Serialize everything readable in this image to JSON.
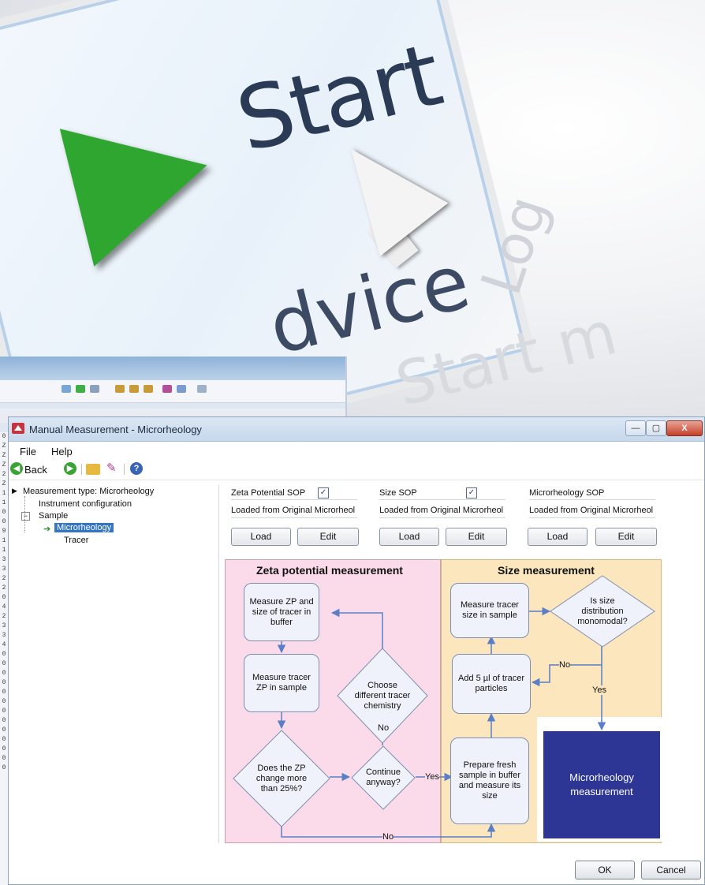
{
  "hero": {
    "start_text": "Start",
    "advice_text": "dvice",
    "log_text": "Log",
    "start_menu_text": "Start m"
  },
  "background_app": {
    "row_digits": [
      "0",
      "Z",
      "Z",
      "Z",
      "2",
      "Z",
      "1",
      "1",
      "0",
      "0",
      "9",
      "1",
      "1",
      "3",
      "3",
      "2",
      "2",
      "0",
      "4",
      "2",
      "3",
      "3",
      "4",
      "0",
      "0",
      "0",
      "0",
      "0",
      "0",
      "0",
      "0",
      "0",
      "0",
      "0",
      "0",
      "0"
    ]
  },
  "window": {
    "title": "Manual Measurement - Microrheology",
    "controls": {
      "minimize": "—",
      "maximize": "▢",
      "close": "X"
    }
  },
  "menu": {
    "file": "File",
    "help": "Help"
  },
  "toolbar": {
    "back_label": "Back"
  },
  "tree": {
    "root": "Measurement type: Microrheology",
    "instrument": "Instrument configuration",
    "sample": "Sample",
    "microrheology": "Microrheology",
    "tracer": "Tracer"
  },
  "sops": [
    {
      "label": "Zeta Potential SOP",
      "checked": true,
      "status": "Loaded from Original Microrheol",
      "load": "Load",
      "edit": "Edit"
    },
    {
      "label": "Size SOP",
      "checked": true,
      "status": "Loaded from Original Microrheol",
      "load": "Load",
      "edit": "Edit"
    },
    {
      "label": "Microrheology SOP",
      "checked": false,
      "status": "Loaded from Original Microrheol",
      "load": "Load",
      "edit": "Edit"
    }
  ],
  "flowchart": {
    "zp_title": "Zeta potential measurement",
    "size_title": "Size measurement",
    "measure_zp": "Measure ZP and size of tracer in buffer",
    "measure_tracer_zp": "Measure tracer ZP in sample",
    "does_change": "Does the ZP change more than 25%?",
    "choose_tracer": "Choose different tracer chemistry",
    "continue_anyway": "Continue anyway?",
    "prepare_fresh": "Prepare fresh sample in buffer and measure its size",
    "add_tracer": "Add 5 µl of tracer particles",
    "measure_size": "Measure tracer size in sample",
    "is_monomodal": "Is size distribution monomodal?",
    "microrheology": "Microrheology measurement",
    "no_1": "No",
    "no_2": "No",
    "no_3": "No",
    "yes_1": "Yes",
    "yes_2": "Yes"
  },
  "dialog_buttons": {
    "ok": "OK",
    "cancel": "Cancel"
  },
  "colors": {
    "zp_panel": "#fbdbe9",
    "size_panel": "#fbe6bd",
    "microrheology_box": "#2d3694",
    "arrow": "#5b7fc7"
  }
}
